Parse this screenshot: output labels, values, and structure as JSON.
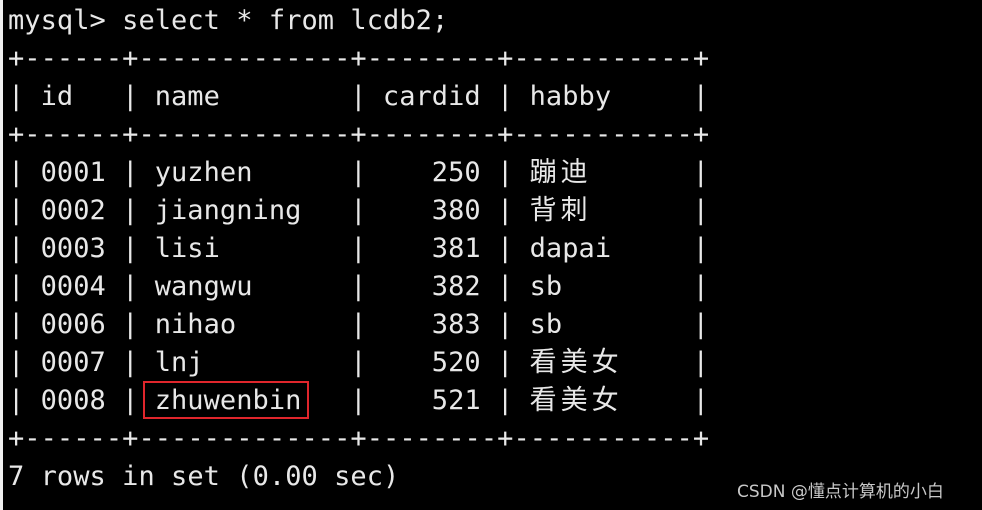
{
  "terminal": {
    "prompt": "mysql> ",
    "command": "select * from lcdb2;",
    "border": "+------+-------------+--------+-----------+",
    "header": {
      "id": "id",
      "name": "name",
      "cardid": "cardid",
      "habby": "habby"
    },
    "rows": [
      {
        "id": "0001",
        "name": "yuzhen",
        "cardid": "250",
        "habby": "蹦迪"
      },
      {
        "id": "0002",
        "name": "jiangning",
        "cardid": "380",
        "habby": "背刺"
      },
      {
        "id": "0003",
        "name": "lisi",
        "cardid": "381",
        "habby": "dapai"
      },
      {
        "id": "0004",
        "name": "wangwu",
        "cardid": "382",
        "habby": "sb"
      },
      {
        "id": "0006",
        "name": "nihao",
        "cardid": "383",
        "habby": "sb"
      },
      {
        "id": "0007",
        "name": "lnj",
        "cardid": "520",
        "habby": "看美女"
      },
      {
        "id": "0008",
        "name": "zhuwenbin",
        "cardid": "521",
        "habby": "看美女"
      }
    ],
    "footer": "7 rows in set (0.00 sec)",
    "highlight_color": "#e0262c"
  },
  "watermark": "CSDN @懂点计算机的小白"
}
